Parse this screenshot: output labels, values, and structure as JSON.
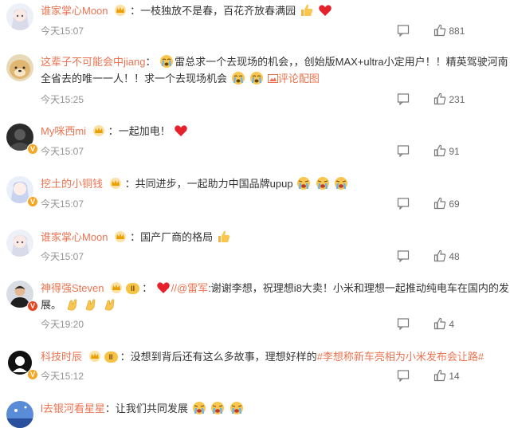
{
  "comments": [
    {
      "user": "谁家掌心Moon",
      "sep": "：",
      "text": "一枝独放不是春，百花齐放春满园",
      "time": "今天15:07",
      "likes": "881"
    },
    {
      "user": "这辈子不可能会中jiang",
      "sep": "：",
      "text": "雷总求一个去现场的机会，，创始版MAX+ultra小定用户！！精英驾驶河南",
      "text2": "全省去的唯一一人！！求一个去现场机会",
      "link": "评论配图",
      "time": "今天15:25",
      "likes": "231"
    },
    {
      "user": "My咪西mi",
      "sep": "：",
      "text": "一起加电！",
      "time": "今天15:07",
      "likes": "91"
    },
    {
      "user": "挖土的小铜钱",
      "sep": "：",
      "text": "共同进步，一起助力中国品牌upup",
      "time": "今天15:07",
      "likes": "69"
    },
    {
      "user": "谁家掌心Moon",
      "sep": "：",
      "text": "国产厂商的格局",
      "time": "今天15:07",
      "likes": "48"
    },
    {
      "user": "神得强Steven",
      "badge": "II",
      "sep": "：",
      "mention": "//@雷军",
      "text": ":谢谢李想，祝理想i8大卖！小米和理想一起推动纯电车在国内的发",
      "text2": "展。",
      "time": "今天19:20",
      "likes": "4"
    },
    {
      "user": "科技时辰",
      "badge": "II",
      "sep": "：",
      "text": "没想到背后还有这么多故事，理想好样的",
      "topic": "#李想称新车亮相为小米发布会让路#",
      "time": "今天15:12",
      "likes": "14"
    },
    {
      "user": "l去银河看星星",
      "sep": "：",
      "text": "让我们共同发展"
    }
  ],
  "icons": {
    "comment": "comment-icon",
    "like": "thumbs-up-icon",
    "heart": "heart-emoji",
    "thumb": "thumbs-up-emoji",
    "cry": "crying-emoji",
    "clap": "clap-emoji",
    "crown": "crown-icon",
    "verified": "verified-badge"
  },
  "colors": {
    "username": "#eb7350",
    "time": "#939393",
    "text": "#333333",
    "verified": "#f5a623"
  }
}
